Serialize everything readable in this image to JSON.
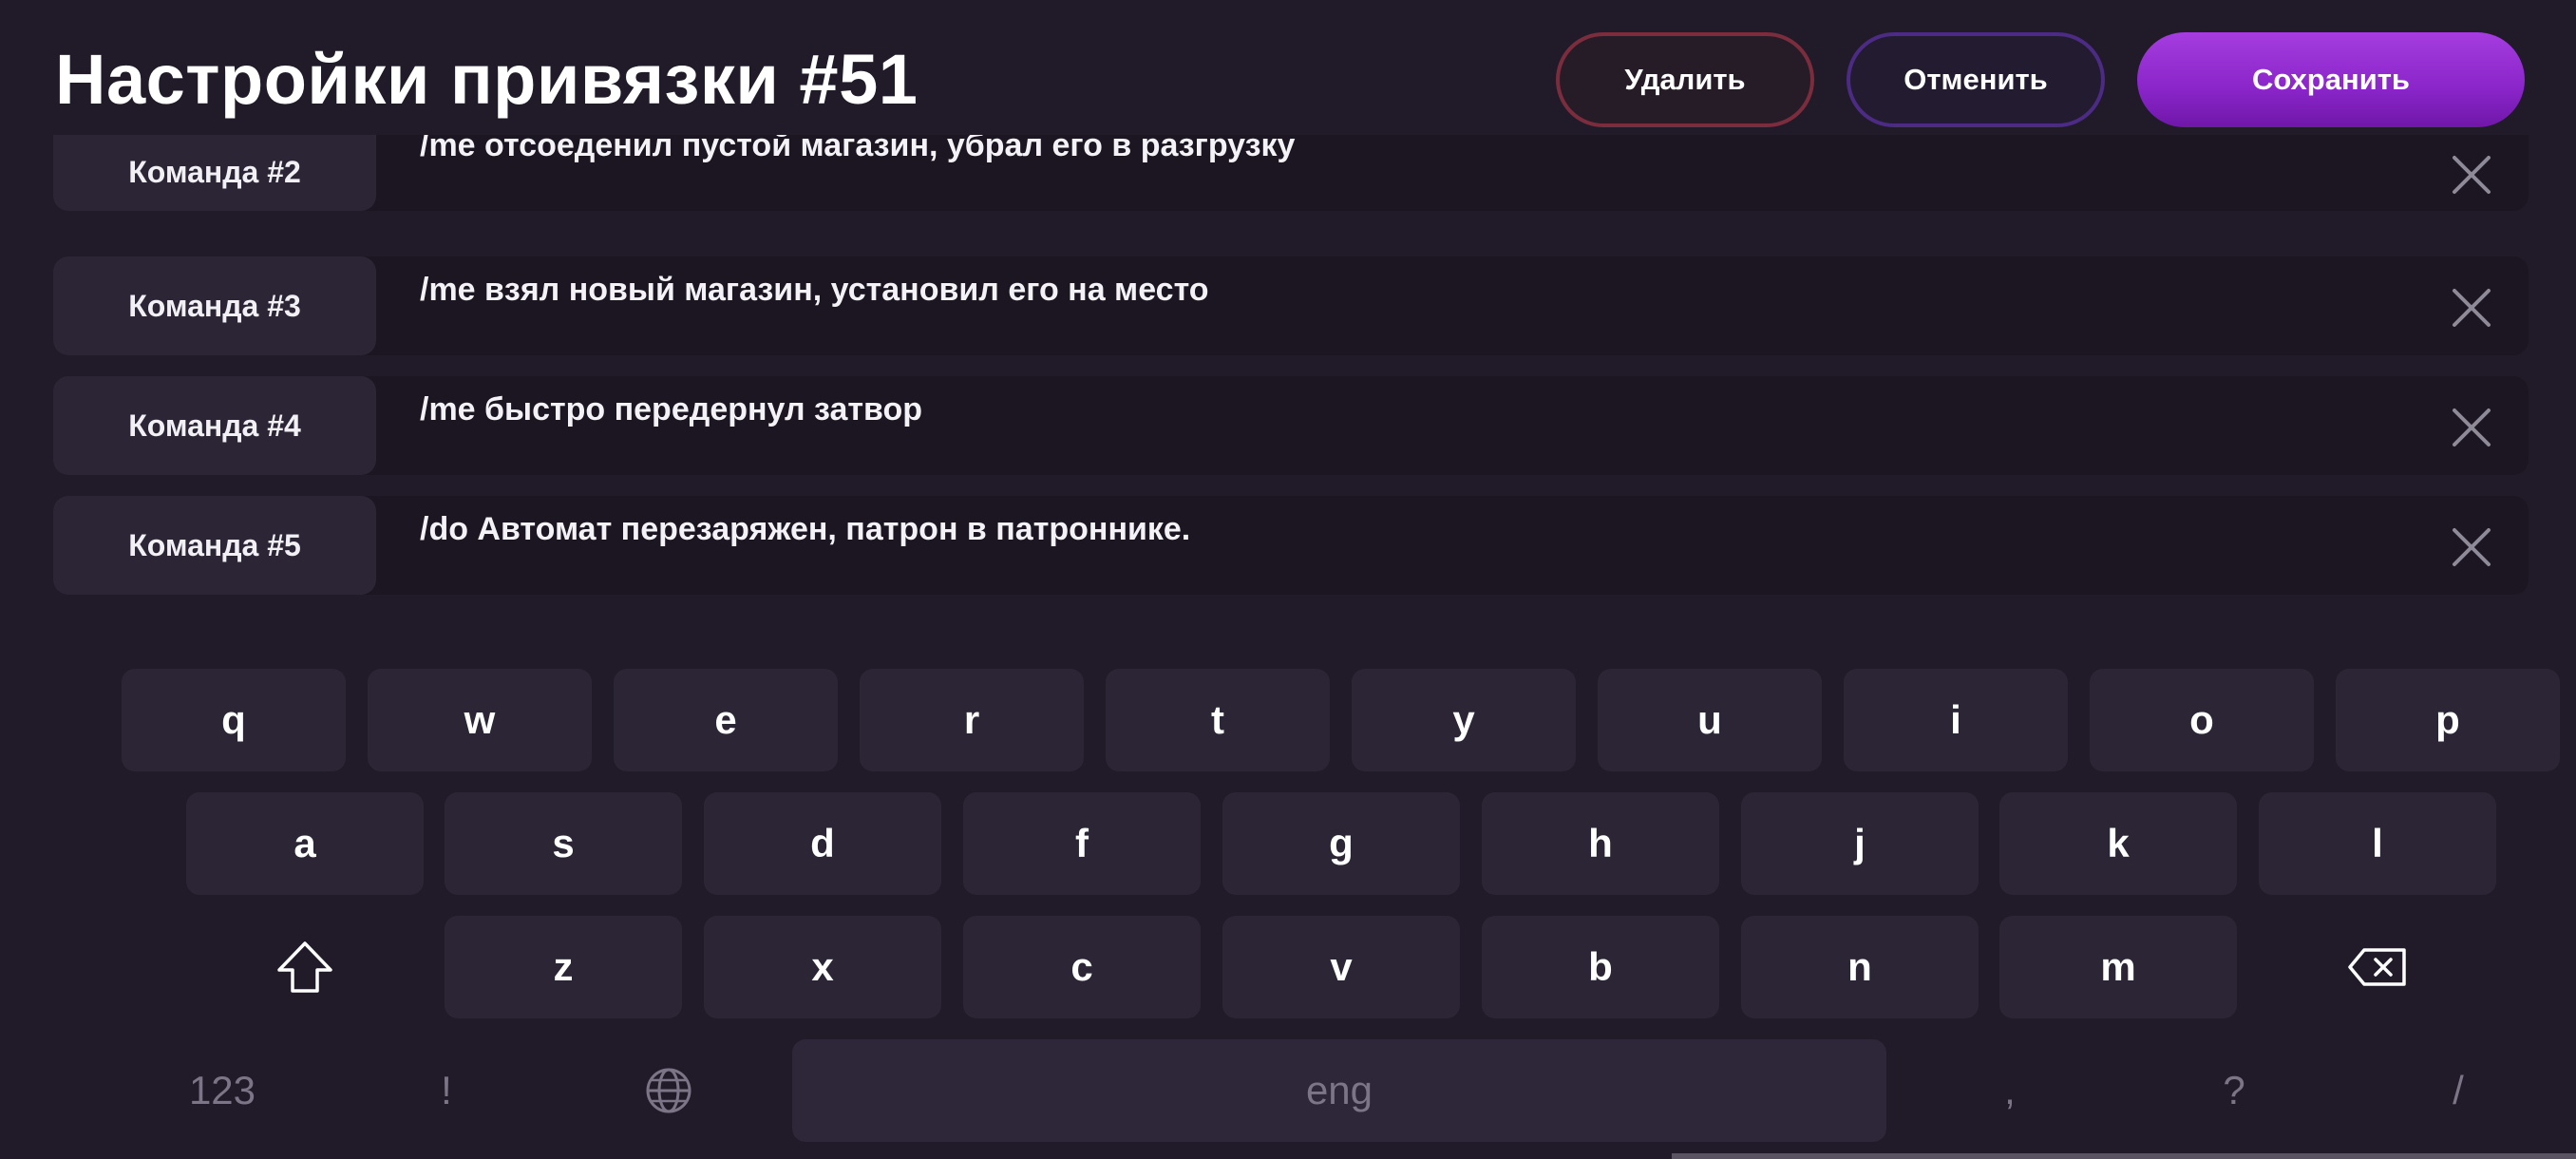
{
  "header": {
    "title": "Настройки привязки #51",
    "delete_label": "Удалить",
    "cancel_label": "Отменить",
    "save_label": "Сохранить"
  },
  "commands": [
    {
      "label": "Команда #2",
      "text": "/me отсоеденил пустой магазин, убрал его в разгрузку"
    },
    {
      "label": "Команда #3",
      "text": "/me взял новый магазин, установил его на место"
    },
    {
      "label": "Команда #4",
      "text": "/me быстро передернул затвор"
    },
    {
      "label": "Команда #5",
      "text": "/do Автомат перезаряжен, патрон в патроннике."
    }
  ],
  "keyboard": {
    "row1": [
      "q",
      "w",
      "e",
      "r",
      "t",
      "y",
      "u",
      "i",
      "o",
      "p"
    ],
    "row2": [
      "a",
      "s",
      "d",
      "f",
      "g",
      "h",
      "j",
      "k",
      "l"
    ],
    "row3": [
      "z",
      "x",
      "c",
      "v",
      "b",
      "n",
      "m"
    ],
    "numbers_label": "123",
    "exclaim_label": "!",
    "space_label": "eng",
    "comma_label": ",",
    "question_label": "?",
    "slash_label": "/",
    "icons": {
      "shift": "shift-icon",
      "backspace": "backspace-icon",
      "language": "globe-icon",
      "remove": "close-icon"
    }
  },
  "colors": {
    "background": "#211b29",
    "key": "#2b2535",
    "accent": "#9a32d8",
    "delete_border": "#7b2d3d",
    "cancel_border": "#4b2b83"
  }
}
